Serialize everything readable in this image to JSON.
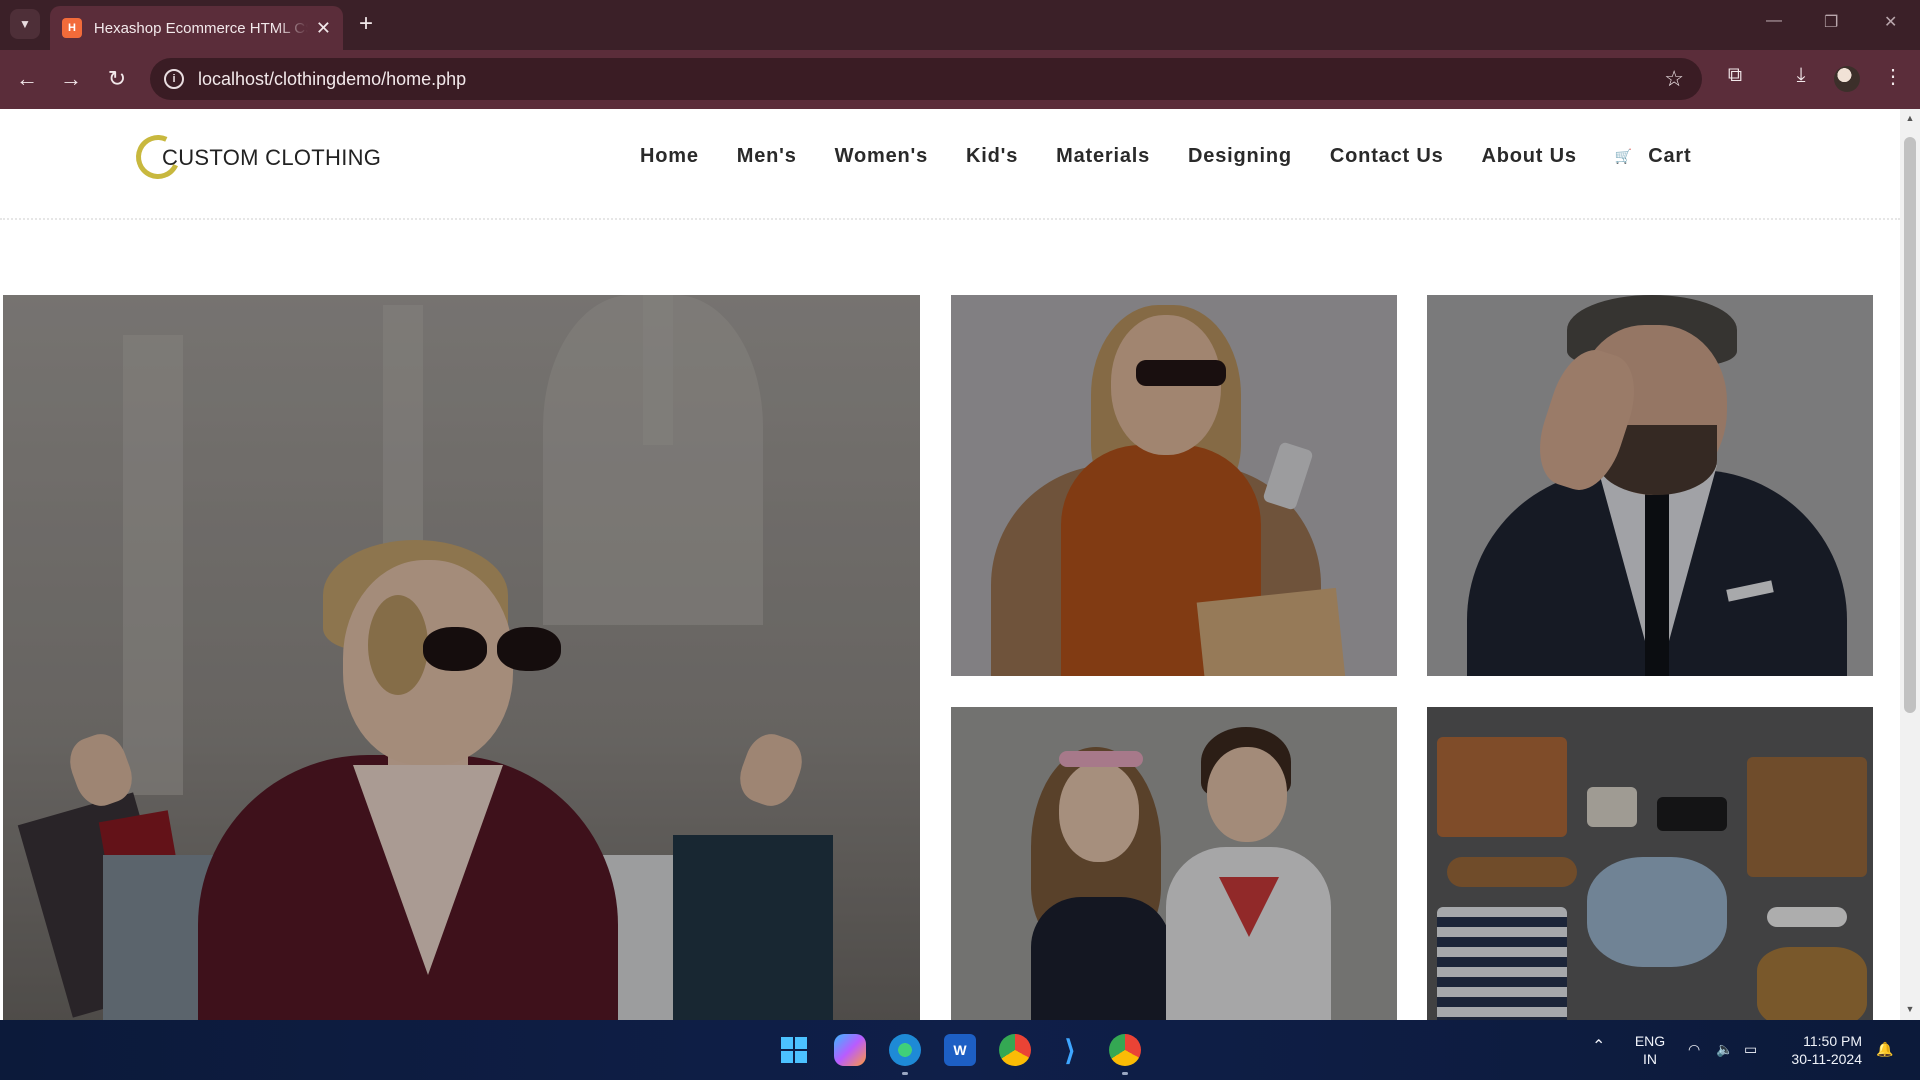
{
  "browser": {
    "tab_title": "Hexashop Ecommerce HTML CSS Template",
    "favicon": "H",
    "url": "localhost/clothingdemo/home.php"
  },
  "site": {
    "logo_text": "CUSTOM CLOTHING",
    "nav": [
      "Home",
      "Men's",
      "Women's",
      "Kid's",
      "Materials",
      "Designing",
      "Contact Us",
      "About Us"
    ],
    "cart_label": "Cart"
  },
  "taskbar": {
    "lang_line1": "ENG",
    "lang_line2": "IN",
    "time": "11:50 PM",
    "date": "30-11-2024"
  },
  "colors": {
    "tabbar": "#3b2028",
    "toolbar": "#5b2d3a",
    "logo_accent": "#c8b83e"
  }
}
